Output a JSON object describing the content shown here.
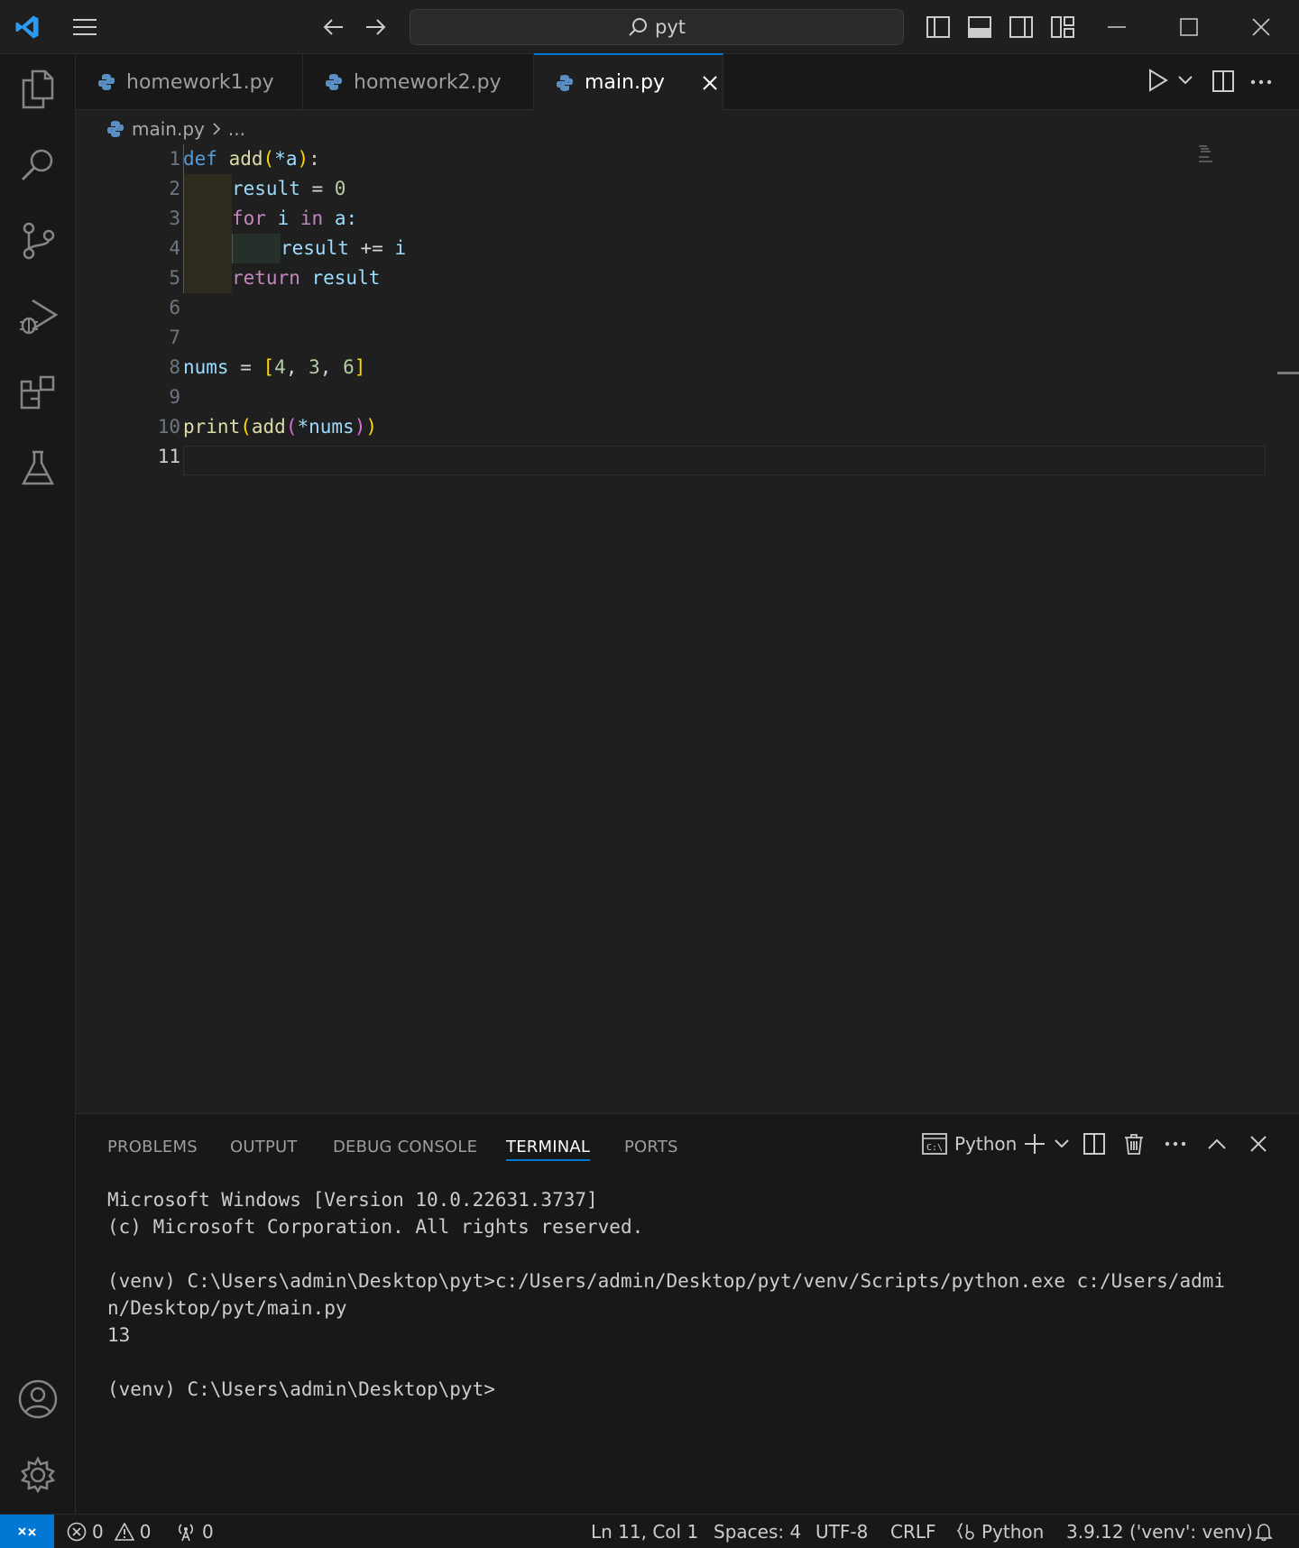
{
  "titlebar": {
    "search_text": "pyt"
  },
  "tabs": [
    {
      "label": "homework1.py"
    },
    {
      "label": "homework2.py"
    },
    {
      "label": "main.py"
    }
  ],
  "breadcrumb": {
    "file": "main.py",
    "more": "..."
  },
  "editor": {
    "line_numbers": [
      "1",
      "2",
      "3",
      "4",
      "5",
      "6",
      "7",
      "8",
      "9",
      "10",
      "11"
    ],
    "code": {
      "l1": [
        "def",
        "add",
        "(",
        "*a",
        ")",
        ":"
      ],
      "l2": [
        "result",
        " = ",
        "0"
      ],
      "l3": [
        "for",
        " i ",
        "in",
        " a:"
      ],
      "l4": [
        "result",
        " += ",
        "i"
      ],
      "l5": [
        "return",
        " result"
      ],
      "l8": [
        "nums",
        " = ",
        "[",
        "4",
        ", ",
        "3",
        ", ",
        "6",
        "]"
      ],
      "l10": [
        "print",
        "(",
        "add",
        "(",
        "*nums",
        ")",
        ")"
      ]
    }
  },
  "panel": {
    "tabs": [
      "PROBLEMS",
      "OUTPUT",
      "DEBUG CONSOLE",
      "TERMINAL",
      "PORTS"
    ],
    "terminal_profile": "Python",
    "terminal_lines": [
      "Microsoft Windows [Version 10.0.22631.3737]",
      "(c) Microsoft Corporation. All rights reserved.",
      "",
      "(venv) C:\\Users\\admin\\Desktop\\pyt>c:/Users/admin/Desktop/pyt/venv/Scripts/python.exe c:/Users/admi",
      "n/Desktop/pyt/main.py",
      "13",
      "",
      "(venv) C:\\Users\\admin\\Desktop\\pyt>"
    ]
  },
  "statusbar": {
    "errors": "0",
    "warnings": "0",
    "ports": "0",
    "position": "Ln 11, Col 1",
    "spaces": "Spaces: 4",
    "encoding": "UTF-8",
    "eol": "CRLF",
    "language": "Python",
    "interpreter": "3.9.12 ('venv': venv)"
  },
  "colors": {
    "accent": "#0078d4",
    "background": "#1f1f1f",
    "sidebar": "#181818"
  }
}
